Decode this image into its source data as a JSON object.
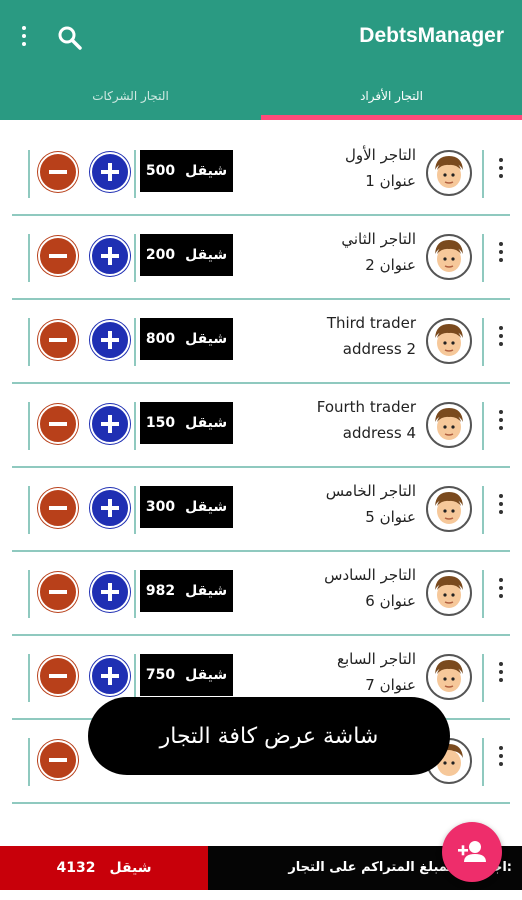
{
  "app": {
    "title": "DebtsManager"
  },
  "tabs": [
    {
      "label": "التجار الأفراد",
      "selected": true
    },
    {
      "label": "التجار الشركات",
      "selected": false
    }
  ],
  "traders": [
    {
      "name": "التاجر الأول",
      "address": "عنوان 1",
      "amount": "500",
      "currency": "شيقل"
    },
    {
      "name": "التاجر الثاني",
      "address": "عنوان 2",
      "amount": "200",
      "currency": "شيقل"
    },
    {
      "name": "Third trader",
      "address": "address 2",
      "amount": "800",
      "currency": "شيقل"
    },
    {
      "name": "Fourth trader",
      "address": "address 4",
      "amount": "150",
      "currency": "شيقل"
    },
    {
      "name": "التاجر الخامس",
      "address": "عنوان 5",
      "amount": "300",
      "currency": "شيقل"
    },
    {
      "name": "التاجر السادس",
      "address": "عنوان 6",
      "amount": "982",
      "currency": "شيقل"
    },
    {
      "name": "التاجر السابع",
      "address": "عنوان 7",
      "amount": "750",
      "currency": "شيقل"
    }
  ],
  "toast": {
    "text": "شاشة عرض كافة التجار"
  },
  "footer": {
    "total_label": "اجمالي المبلغ المتراكم على التجار:",
    "total_amount": "4132",
    "total_currency": "شيقل"
  },
  "colors": {
    "primary": "#2a9a82",
    "accent": "#ff4a7a",
    "plus": "#1f2fb3",
    "minus": "#b8401a",
    "fab": "#ee2d6b",
    "total": "#c8000a"
  }
}
